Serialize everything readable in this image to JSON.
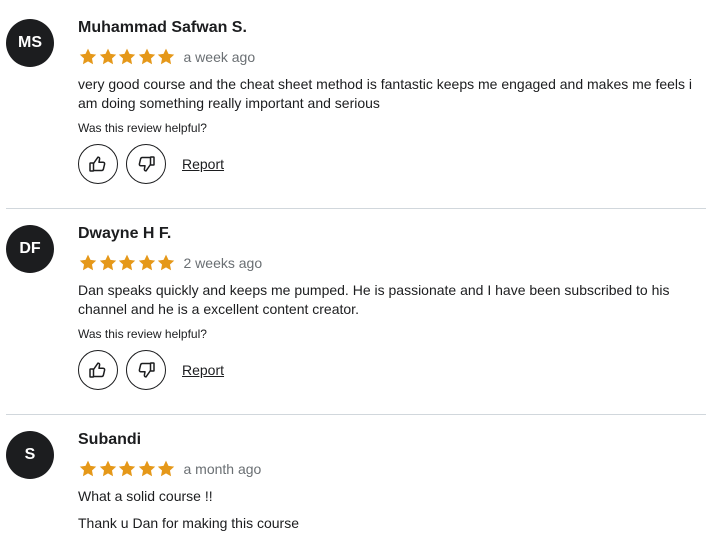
{
  "reviews": [
    {
      "initials": "MS",
      "name": "Muhammad Safwan S.",
      "rating": 5,
      "time": "a week ago",
      "paragraphs": [
        "very good course and the cheat sheet method is fantastic keeps me engaged and makes me feels i am doing something really important and serious"
      ],
      "helpful_label": "Was this review helpful?",
      "report_label": "Report"
    },
    {
      "initials": "DF",
      "name": "Dwayne H F.",
      "rating": 5,
      "time": "2 weeks ago",
      "paragraphs": [
        "Dan speaks quickly and keeps me pumped. He is passionate and I have been subscribed to his channel and he is a excellent content creator."
      ],
      "helpful_label": "Was this review helpful?",
      "report_label": "Report"
    },
    {
      "initials": "S",
      "name": "Subandi",
      "rating": 5,
      "time": "a month ago",
      "paragraphs": [
        "What a solid course !!",
        "Thank u Dan for making this course"
      ]
    }
  ],
  "colors": {
    "star": "#e59819",
    "avatar_bg": "#1c1d1f",
    "text": "#1c1d1f",
    "muted": "#6a6f73",
    "divider": "#d1d7dc"
  },
  "icons": {
    "star": "star-icon",
    "like": "thumbs-up-icon",
    "dislike": "thumbs-down-icon"
  }
}
